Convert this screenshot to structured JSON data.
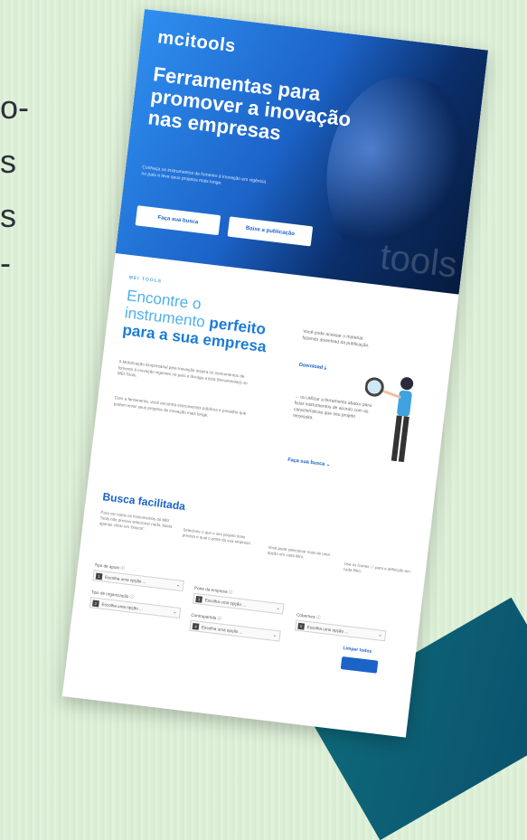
{
  "background_fragments": [
    "o-",
    "s",
    "s",
    "-"
  ],
  "colors": {
    "accent": "#1c63c8",
    "hero_dark": "#061b3e",
    "background": "#dff0d9"
  },
  "page": {
    "logo": "mcitools",
    "hero": {
      "title": "Ferramentas para promover a inovação nas empresas",
      "subtitle": "Conheça os instrumentos de fomento à inovação em vigência no país e leve seus projetos mais longe.",
      "btn_search": "Faça sua busca",
      "btn_download": "Baixe a publicação",
      "watermark": "tools"
    },
    "section": {
      "kicker": "MEI TOOLS",
      "title_plain": "Encontre o instrumento",
      "title_bold": "perfeito para a sua empresa",
      "para1": "A Mobilização Empresarial pela Inovação inspira os instrumentos de fomento à inovação vigentes no país e divulga a lista (ferramentas) no MEI Tools.",
      "para2": "Com a ferramenta, você encontra instrumentos públicos e privados que podem levar seus projetos de inovação mais longe.",
      "right1": "Você pode acessar o material fazendo download da publicação.",
      "download_link": "Download",
      "right2": "... ou utilizar a ferramenta abaixo para listar instrumentos de acordo com as características que seu projeto necessita.",
      "search_link": "Faça sua busca"
    },
    "busca": {
      "title": "Busca facilitada",
      "hint1": "Para ver todos os instrumentos do MEI Tools não precisa selecionar nada, basta apenas clicar em 'buscar'.",
      "hint2": "Selecione o que o seu projeto mais precisa e qual o porte da sua empresa.",
      "hint3": "Você pode selecionar mais de uma opção em cada filtro.",
      "hint4": "Use os ícones ⓘ para a definição em cada filtro.",
      "filters": [
        {
          "label": "Tipo de apoio ⓘ",
          "num": "1",
          "value": "Escolha uma opção ..."
        },
        {
          "label": "Tipo de organização ⓘ",
          "num": "2",
          "value": "Escolha uma opção ..."
        },
        {
          "label": "Porte da empresa ⓘ",
          "num": "3",
          "value": "Escolha uma opção ..."
        },
        {
          "label": "Contrapartida ⓘ",
          "num": "4",
          "value": "Escolha uma opção ..."
        },
        {
          "label": "Cobertura ⓘ",
          "num": "5",
          "value": "Escolha uma opção ..."
        }
      ],
      "clear": "Limpar todos",
      "search_button": ""
    }
  }
}
